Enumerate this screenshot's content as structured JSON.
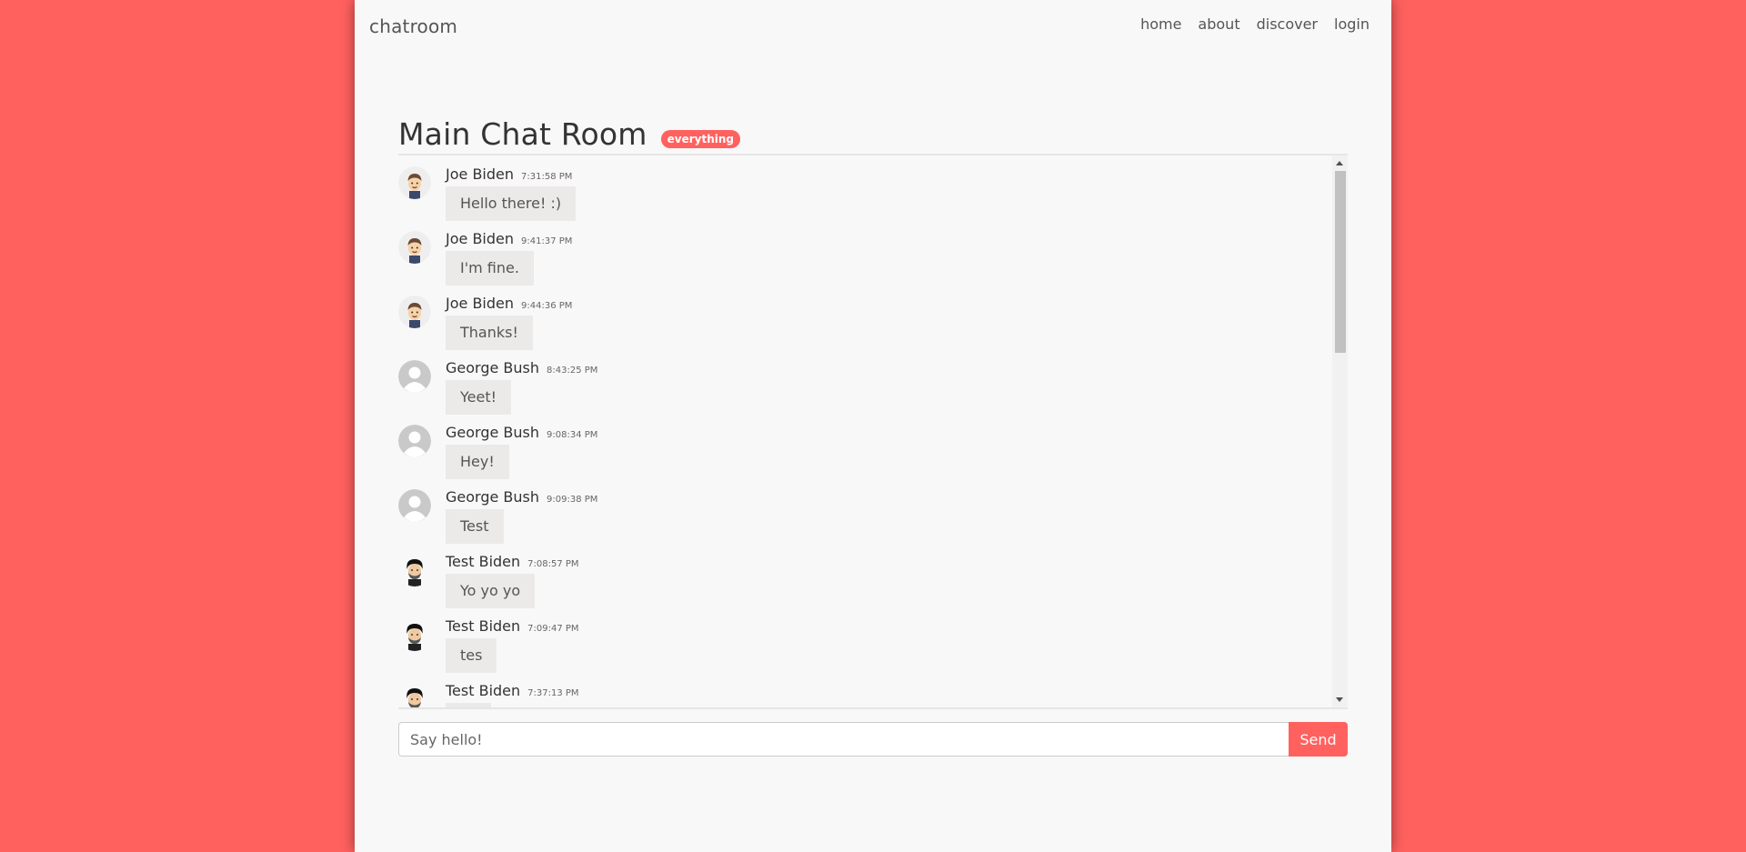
{
  "nav": {
    "brand": "chatroom",
    "links": [
      "home",
      "about",
      "discover",
      "login"
    ]
  },
  "room": {
    "title": "Main Chat Room",
    "tag": "everything"
  },
  "messages": [
    {
      "author": "Joe Biden",
      "time": "7:31:58 PM",
      "text": "Hello there! :)",
      "avatar": "cartoon-man-avatar-icon"
    },
    {
      "author": "Joe Biden",
      "time": "9:41:37 PM",
      "text": "I'm fine.",
      "avatar": "cartoon-man-avatar-icon"
    },
    {
      "author": "Joe Biden",
      "time": "9:44:36 PM",
      "text": "Thanks!",
      "avatar": "cartoon-man-avatar-icon"
    },
    {
      "author": "George Bush",
      "time": "8:43:25 PM",
      "text": "Yeet!",
      "avatar": "default-user-avatar-icon"
    },
    {
      "author": "George Bush",
      "time": "9:08:34 PM",
      "text": "Hey!",
      "avatar": "default-user-avatar-icon"
    },
    {
      "author": "George Bush",
      "time": "9:09:38 PM",
      "text": "Test",
      "avatar": "default-user-avatar-icon"
    },
    {
      "author": "Test Biden",
      "time": "7:08:57 PM",
      "text": "Yo yo yo",
      "avatar": "bearded-man-avatar-icon"
    },
    {
      "author": "Test Biden",
      "time": "7:09:47 PM",
      "text": "tes",
      "avatar": "bearded-man-avatar-icon"
    },
    {
      "author": "Test Biden",
      "time": "7:37:13 PM",
      "text": "",
      "avatar": "bearded-man-avatar-icon"
    }
  ],
  "composer": {
    "placeholder": "Say hello!",
    "send_label": "Send"
  },
  "colors": {
    "accent": "#ff615f",
    "page_background": "#f8f8f8",
    "bubble": "#ece9e9"
  }
}
